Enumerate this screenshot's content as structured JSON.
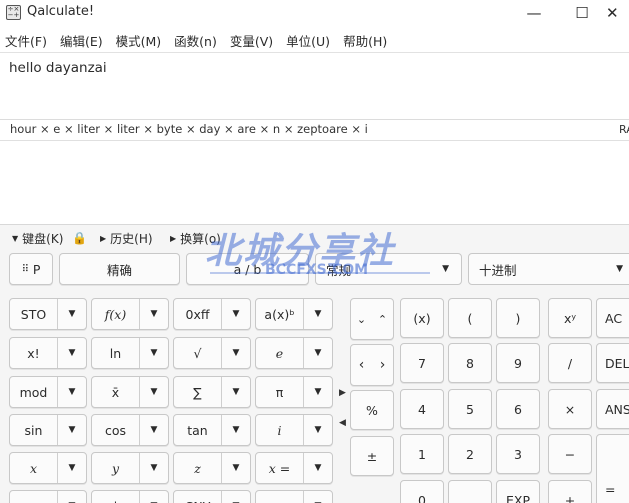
{
  "window": {
    "title": "Qalculate!",
    "minimize": "—",
    "maximize": "☐",
    "close": "✕"
  },
  "menu": [
    "文件(F)",
    "编辑(E)",
    "模式(M)",
    "函数(n)",
    "变量(V)",
    "单位(U)",
    "帮助(H)"
  ],
  "expression": {
    "text": "hello dayanzai"
  },
  "parsed": {
    "text": "hour × e × liter × liter × byte × day × are × n × zeptoare × i",
    "mode_indicator": "RA"
  },
  "toggles": {
    "keypad": "键盘(K)",
    "history": "历史(H)",
    "convert": "换算(o)"
  },
  "toolbar": {
    "grid_label": "P",
    "exact": "精确",
    "fraction": "a / b",
    "format": "常规",
    "base": "十进制"
  },
  "func_buttons": [
    [
      "STO",
      "f(x)",
      "0xff",
      "a(x)ᵇ"
    ],
    [
      "x!",
      "ln",
      "√",
      "e"
    ],
    [
      "mod",
      "x̄",
      "∑",
      "π"
    ],
    [
      "sin",
      "cos",
      "tan",
      "i"
    ],
    [
      "x",
      "y",
      "z",
      "x ="
    ],
    [
      "",
      "|",
      "CNY",
      ""
    ]
  ],
  "nav_buttons": {
    "down": "⌄",
    "up": "⌃",
    "left": "‹",
    "right": "›"
  },
  "num_buttons": [
    [
      "(x)",
      "(",
      ")",
      "xʸ",
      "AC"
    ],
    [
      "7",
      "8",
      "9",
      "/",
      "DEL"
    ],
    [
      "4",
      "5",
      "6",
      "×",
      "ANS"
    ],
    [
      "1",
      "2",
      "3",
      "−",
      "="
    ],
    [
      "0",
      ".",
      "EXP",
      "+",
      ""
    ]
  ],
  "side_buttons": [
    "%",
    "±"
  ],
  "watermark": {
    "main": "北城分享社",
    "sub": "BCCFXS.COM"
  }
}
